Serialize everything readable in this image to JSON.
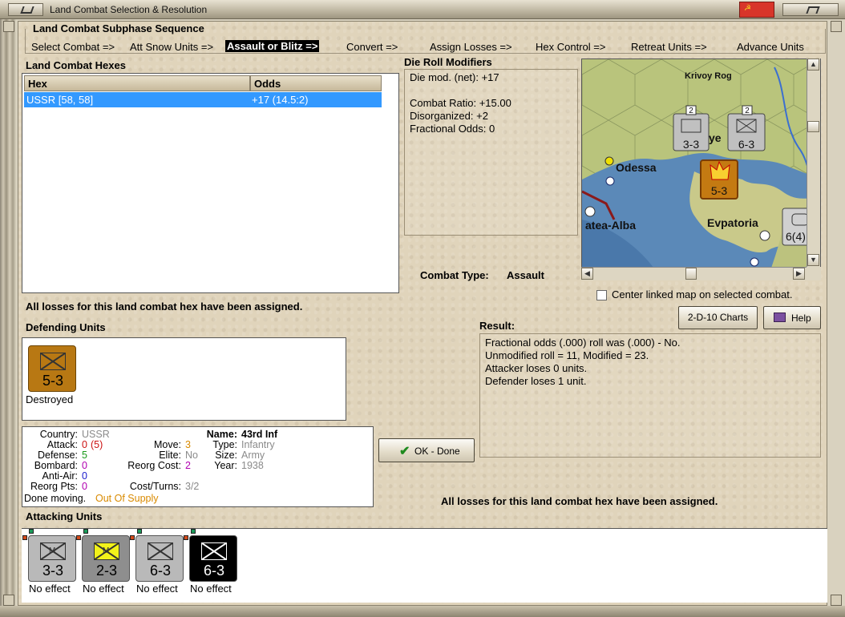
{
  "window": {
    "title": "Land Combat Selection & Resolution",
    "flag_glyph": "☭"
  },
  "subphase": {
    "title": "Land Combat Subphase Sequence",
    "steps": [
      "Select Combat =>",
      "Att Snow Units =>",
      "Assault or Blitz =>",
      "Convert =>",
      "Assign Losses =>",
      "Hex Control =>",
      "Retreat Units =>",
      "Advance Units"
    ],
    "active_step": "Assault or Blitz =>"
  },
  "hexes": {
    "title": "Land Combat Hexes",
    "columns": [
      "Hex",
      "Odds"
    ],
    "rows": [
      {
        "hex": "USSR [58, 58]",
        "odds": "+17 (14.5:2)",
        "selected": true
      }
    ],
    "losses_message": "All losses for this land combat hex have been assigned."
  },
  "die_roll": {
    "title": "Die Roll Modifiers",
    "lines": [
      "Die mod. (net): +17",
      "",
      "Combat Ratio: +15.00",
      "Disorganized: +2",
      "Fractional Odds: 0"
    ]
  },
  "combat_type": {
    "label": "Combat Type:",
    "value": "Assault"
  },
  "map": {
    "labels": {
      "city1": "Krivoy Rog",
      "city2": "Odessa",
      "city3": "atea-Alba",
      "city4": "Evpatoria",
      "partial": "ye"
    },
    "counters": [
      {
        "value": "3-3",
        "stack": "2"
      },
      {
        "value": "6-3",
        "stack": "2"
      },
      {
        "value": "5-3"
      },
      {
        "value": "6(4)"
      }
    ],
    "center_label": "Center linked map on selected combat.",
    "center_checked": false
  },
  "buttons": {
    "charts": "2-D-10 Charts",
    "help": "Help",
    "ok": "OK - Done"
  },
  "defending": {
    "title": "Defending Units",
    "units": [
      {
        "value": "5-3",
        "status": "Destroyed",
        "color": "#b87813"
      }
    ]
  },
  "result": {
    "title": "Result:",
    "lines": [
      "Fractional odds (.000) roll was (.000)  - No.",
      "Unmodified roll = 11, Modified = 23.",
      "Attacker loses 0 units.",
      "Defender loses 1 unit."
    ],
    "losses_message": "All losses for this land combat hex have been assigned."
  },
  "unit_info": {
    "country_label": "Country:",
    "country": "USSR",
    "attack_label": "Attack:",
    "attack": "0",
    "attack_extra": "(5)",
    "defense_label": "Defense:",
    "defense": "5",
    "bombard_label": "Bombard:",
    "bombard": "0",
    "antiair_label": "Anti-Air:",
    "antiair": "0",
    "reorg_label": "Reorg Pts:",
    "reorg": "0",
    "move_label": "Move:",
    "move": "3",
    "elite_label": "Elite:",
    "elite": "No",
    "reorg_cost_label": "Reorg Cost:",
    "reorg_cost": "2",
    "cost_turns_label": "Cost/Turns:",
    "cost_turns": "3/2",
    "name_label": "Name:",
    "name": "43rd Inf",
    "type_label": "Type:",
    "type": "Infantry",
    "size_label": "Size:",
    "size": "Army",
    "year_label": "Year:",
    "year": "1938",
    "done_moving": "Done moving.",
    "supply": "Out Of Supply"
  },
  "attacking": {
    "title": "Attacking Units",
    "units": [
      {
        "value": "3-3",
        "mech": "M",
        "status": "No effect",
        "color": "#b9b9b9"
      },
      {
        "value": "2-3",
        "mech": "M",
        "status": "No effect",
        "color": "#8e8e8e"
      },
      {
        "value": "6-3",
        "mech": "",
        "status": "No effect",
        "color": "#b9b9b9"
      },
      {
        "value": "6-3",
        "mech": "",
        "status": "No effect",
        "color": "#000000"
      }
    ]
  },
  "colors": {
    "accent_selection": "#3399ff",
    "gray_value": "#8a8a8a",
    "red_value": "#cc1111",
    "green_value": "#1a9a1a",
    "magenta_value": "#b000b0",
    "blue_value": "#1a1acc",
    "orange_value": "#d98a00"
  }
}
